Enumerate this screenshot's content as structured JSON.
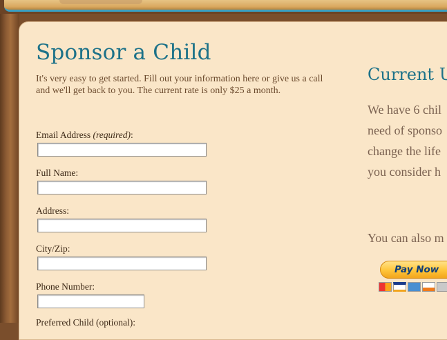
{
  "page": {
    "title": "Sponsor a Child",
    "intro": "It's very easy to get started. Fill out your information here or give us a call and we'll get back to you. The current rate is only $25 a month."
  },
  "form": {
    "email_label": "Email Address",
    "required_note": "(required)",
    "email_suffix": ":",
    "fullname_label": "Full Name:",
    "address_label": "Address:",
    "cityzip_label": "City/Zip:",
    "phone_label": "Phone Number:",
    "email_value": "",
    "fullname_value": "",
    "address_value": "",
    "cityzip_value": "",
    "phone_value": "",
    "next_label_cut": "Preferred Child (optional):"
  },
  "sidebar": {
    "heading": "Current Un",
    "lines": [
      "We have 6 chil",
      "need of sponso",
      "change the life",
      "you consider h"
    ],
    "also": "You can also m",
    "paypal_label": "Pay Now",
    "cards": [
      "mastercard-icon",
      "visa-icon",
      "amex-icon",
      "discover-icon",
      "bank-icon"
    ]
  },
  "colors": {
    "heading": "#1d7289",
    "panel": "#fae6c8",
    "frame": "#7a4e2c",
    "accent_line": "#3aa0c4"
  }
}
